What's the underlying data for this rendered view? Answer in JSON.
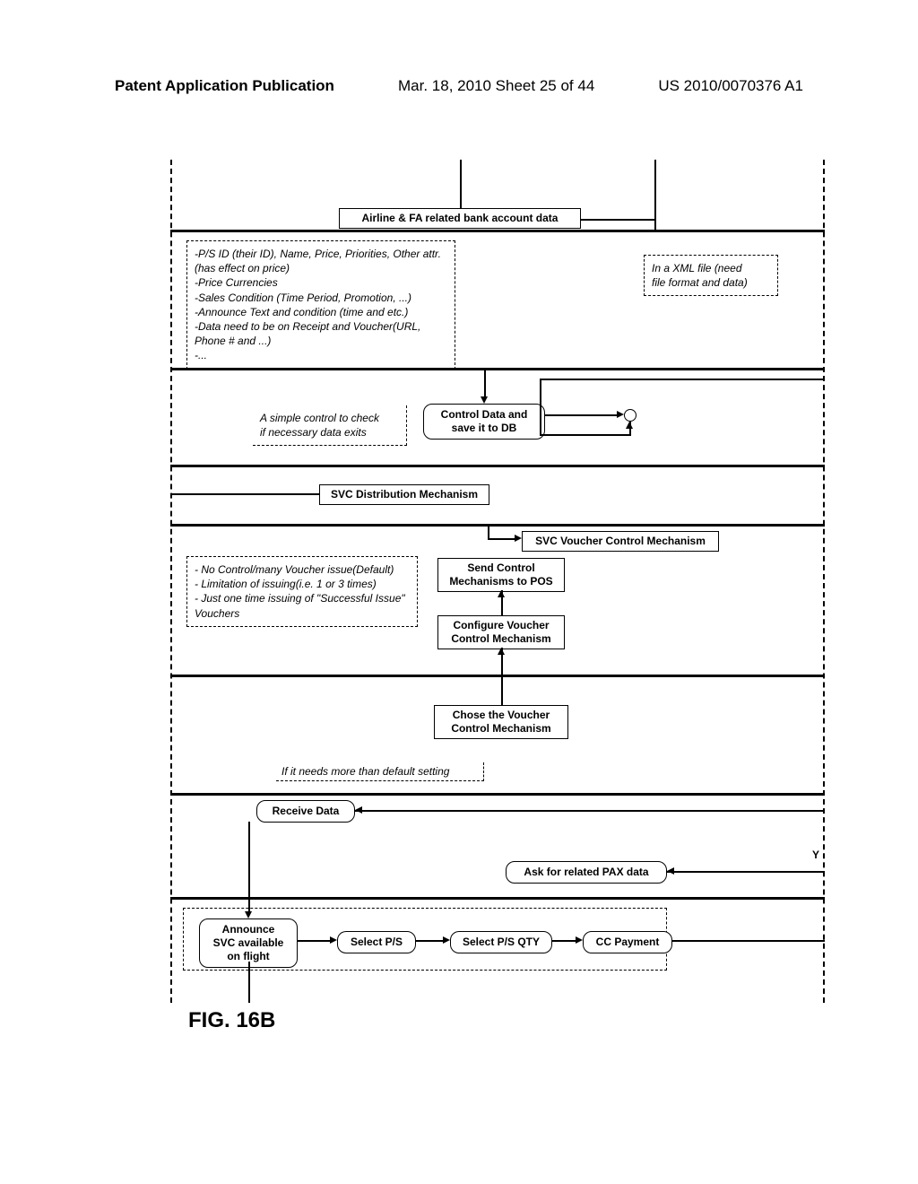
{
  "header": {
    "left": "Patent Application Publication",
    "center": "Mar. 18, 2010  Sheet 25 of 44",
    "right": "US 2010/0070376 A1"
  },
  "lane1": {
    "bank_box": "Airline & FA related bank account data"
  },
  "lane2": {
    "left_note": "-P/S ID (their ID), Name, Price, Priorities, Other attr.\n(has effect on price)\n-Price Currencies\n-Sales Condition (Time Period, Promotion, ...)\n-Announce Text and condition (time and etc.)\n-Data need to be on Receipt and Voucher(URL,\nPhone # and ...)\n-...",
    "right_note": "In a XML file (need\nfile format and data)"
  },
  "lane3": {
    "left_note": "A simple control to check\nif necessary data exits",
    "control_box": "Control Data and\nsave it to DB"
  },
  "lane4": {
    "dist_box": "SVC Distribution Mechanism"
  },
  "lane5": {
    "voucher_ctrl_box": "SVC Voucher Control Mechanism",
    "left_note": "- No Control/many Voucher issue(Default)\n- Limitation of issuing(i.e. 1 or 3 times)\n- Just one time issuing of \"Successful Issue\"\nVouchers",
    "send_box": "Send Control\nMechanisms to POS",
    "configure_box": "Configure Voucher\nControl Mechanism"
  },
  "lane6": {
    "chose_box": "Chose the Voucher\nControl Mechanism",
    "note": "If it needs more than default setting"
  },
  "lane7": {
    "receive_box": "Receive Data",
    "ask_box": "Ask for related PAX data",
    "y_label": "Y"
  },
  "lane8": {
    "announce": "Announce\nSVC available\non flight",
    "select_ps": "Select P/S",
    "select_qty": "Select P/S QTY",
    "cc_payment": "CC Payment"
  },
  "figure_label": "FIG. 16B"
}
